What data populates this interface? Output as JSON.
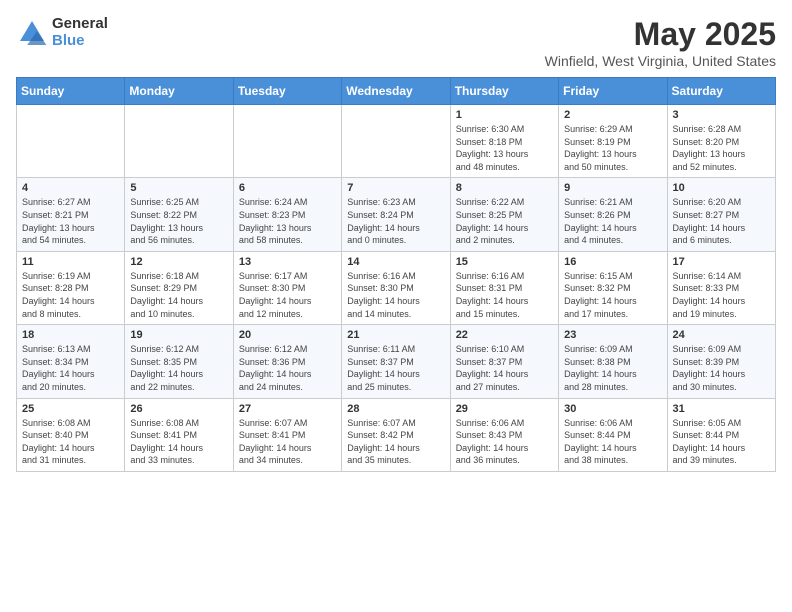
{
  "header": {
    "logo_general": "General",
    "logo_blue": "Blue",
    "month_title": "May 2025",
    "location": "Winfield, West Virginia, United States"
  },
  "days_of_week": [
    "Sunday",
    "Monday",
    "Tuesday",
    "Wednesday",
    "Thursday",
    "Friday",
    "Saturday"
  ],
  "weeks": [
    [
      {
        "day": "",
        "info": ""
      },
      {
        "day": "",
        "info": ""
      },
      {
        "day": "",
        "info": ""
      },
      {
        "day": "",
        "info": ""
      },
      {
        "day": "1",
        "info": "Sunrise: 6:30 AM\nSunset: 8:18 PM\nDaylight: 13 hours\nand 48 minutes."
      },
      {
        "day": "2",
        "info": "Sunrise: 6:29 AM\nSunset: 8:19 PM\nDaylight: 13 hours\nand 50 minutes."
      },
      {
        "day": "3",
        "info": "Sunrise: 6:28 AM\nSunset: 8:20 PM\nDaylight: 13 hours\nand 52 minutes."
      }
    ],
    [
      {
        "day": "4",
        "info": "Sunrise: 6:27 AM\nSunset: 8:21 PM\nDaylight: 13 hours\nand 54 minutes."
      },
      {
        "day": "5",
        "info": "Sunrise: 6:25 AM\nSunset: 8:22 PM\nDaylight: 13 hours\nand 56 minutes."
      },
      {
        "day": "6",
        "info": "Sunrise: 6:24 AM\nSunset: 8:23 PM\nDaylight: 13 hours\nand 58 minutes."
      },
      {
        "day": "7",
        "info": "Sunrise: 6:23 AM\nSunset: 8:24 PM\nDaylight: 14 hours\nand 0 minutes."
      },
      {
        "day": "8",
        "info": "Sunrise: 6:22 AM\nSunset: 8:25 PM\nDaylight: 14 hours\nand 2 minutes."
      },
      {
        "day": "9",
        "info": "Sunrise: 6:21 AM\nSunset: 8:26 PM\nDaylight: 14 hours\nand 4 minutes."
      },
      {
        "day": "10",
        "info": "Sunrise: 6:20 AM\nSunset: 8:27 PM\nDaylight: 14 hours\nand 6 minutes."
      }
    ],
    [
      {
        "day": "11",
        "info": "Sunrise: 6:19 AM\nSunset: 8:28 PM\nDaylight: 14 hours\nand 8 minutes."
      },
      {
        "day": "12",
        "info": "Sunrise: 6:18 AM\nSunset: 8:29 PM\nDaylight: 14 hours\nand 10 minutes."
      },
      {
        "day": "13",
        "info": "Sunrise: 6:17 AM\nSunset: 8:30 PM\nDaylight: 14 hours\nand 12 minutes."
      },
      {
        "day": "14",
        "info": "Sunrise: 6:16 AM\nSunset: 8:30 PM\nDaylight: 14 hours\nand 14 minutes."
      },
      {
        "day": "15",
        "info": "Sunrise: 6:16 AM\nSunset: 8:31 PM\nDaylight: 14 hours\nand 15 minutes."
      },
      {
        "day": "16",
        "info": "Sunrise: 6:15 AM\nSunset: 8:32 PM\nDaylight: 14 hours\nand 17 minutes."
      },
      {
        "day": "17",
        "info": "Sunrise: 6:14 AM\nSunset: 8:33 PM\nDaylight: 14 hours\nand 19 minutes."
      }
    ],
    [
      {
        "day": "18",
        "info": "Sunrise: 6:13 AM\nSunset: 8:34 PM\nDaylight: 14 hours\nand 20 minutes."
      },
      {
        "day": "19",
        "info": "Sunrise: 6:12 AM\nSunset: 8:35 PM\nDaylight: 14 hours\nand 22 minutes."
      },
      {
        "day": "20",
        "info": "Sunrise: 6:12 AM\nSunset: 8:36 PM\nDaylight: 14 hours\nand 24 minutes."
      },
      {
        "day": "21",
        "info": "Sunrise: 6:11 AM\nSunset: 8:37 PM\nDaylight: 14 hours\nand 25 minutes."
      },
      {
        "day": "22",
        "info": "Sunrise: 6:10 AM\nSunset: 8:37 PM\nDaylight: 14 hours\nand 27 minutes."
      },
      {
        "day": "23",
        "info": "Sunrise: 6:09 AM\nSunset: 8:38 PM\nDaylight: 14 hours\nand 28 minutes."
      },
      {
        "day": "24",
        "info": "Sunrise: 6:09 AM\nSunset: 8:39 PM\nDaylight: 14 hours\nand 30 minutes."
      }
    ],
    [
      {
        "day": "25",
        "info": "Sunrise: 6:08 AM\nSunset: 8:40 PM\nDaylight: 14 hours\nand 31 minutes."
      },
      {
        "day": "26",
        "info": "Sunrise: 6:08 AM\nSunset: 8:41 PM\nDaylight: 14 hours\nand 33 minutes."
      },
      {
        "day": "27",
        "info": "Sunrise: 6:07 AM\nSunset: 8:41 PM\nDaylight: 14 hours\nand 34 minutes."
      },
      {
        "day": "28",
        "info": "Sunrise: 6:07 AM\nSunset: 8:42 PM\nDaylight: 14 hours\nand 35 minutes."
      },
      {
        "day": "29",
        "info": "Sunrise: 6:06 AM\nSunset: 8:43 PM\nDaylight: 14 hours\nand 36 minutes."
      },
      {
        "day": "30",
        "info": "Sunrise: 6:06 AM\nSunset: 8:44 PM\nDaylight: 14 hours\nand 38 minutes."
      },
      {
        "day": "31",
        "info": "Sunrise: 6:05 AM\nSunset: 8:44 PM\nDaylight: 14 hours\nand 39 minutes."
      }
    ]
  ]
}
